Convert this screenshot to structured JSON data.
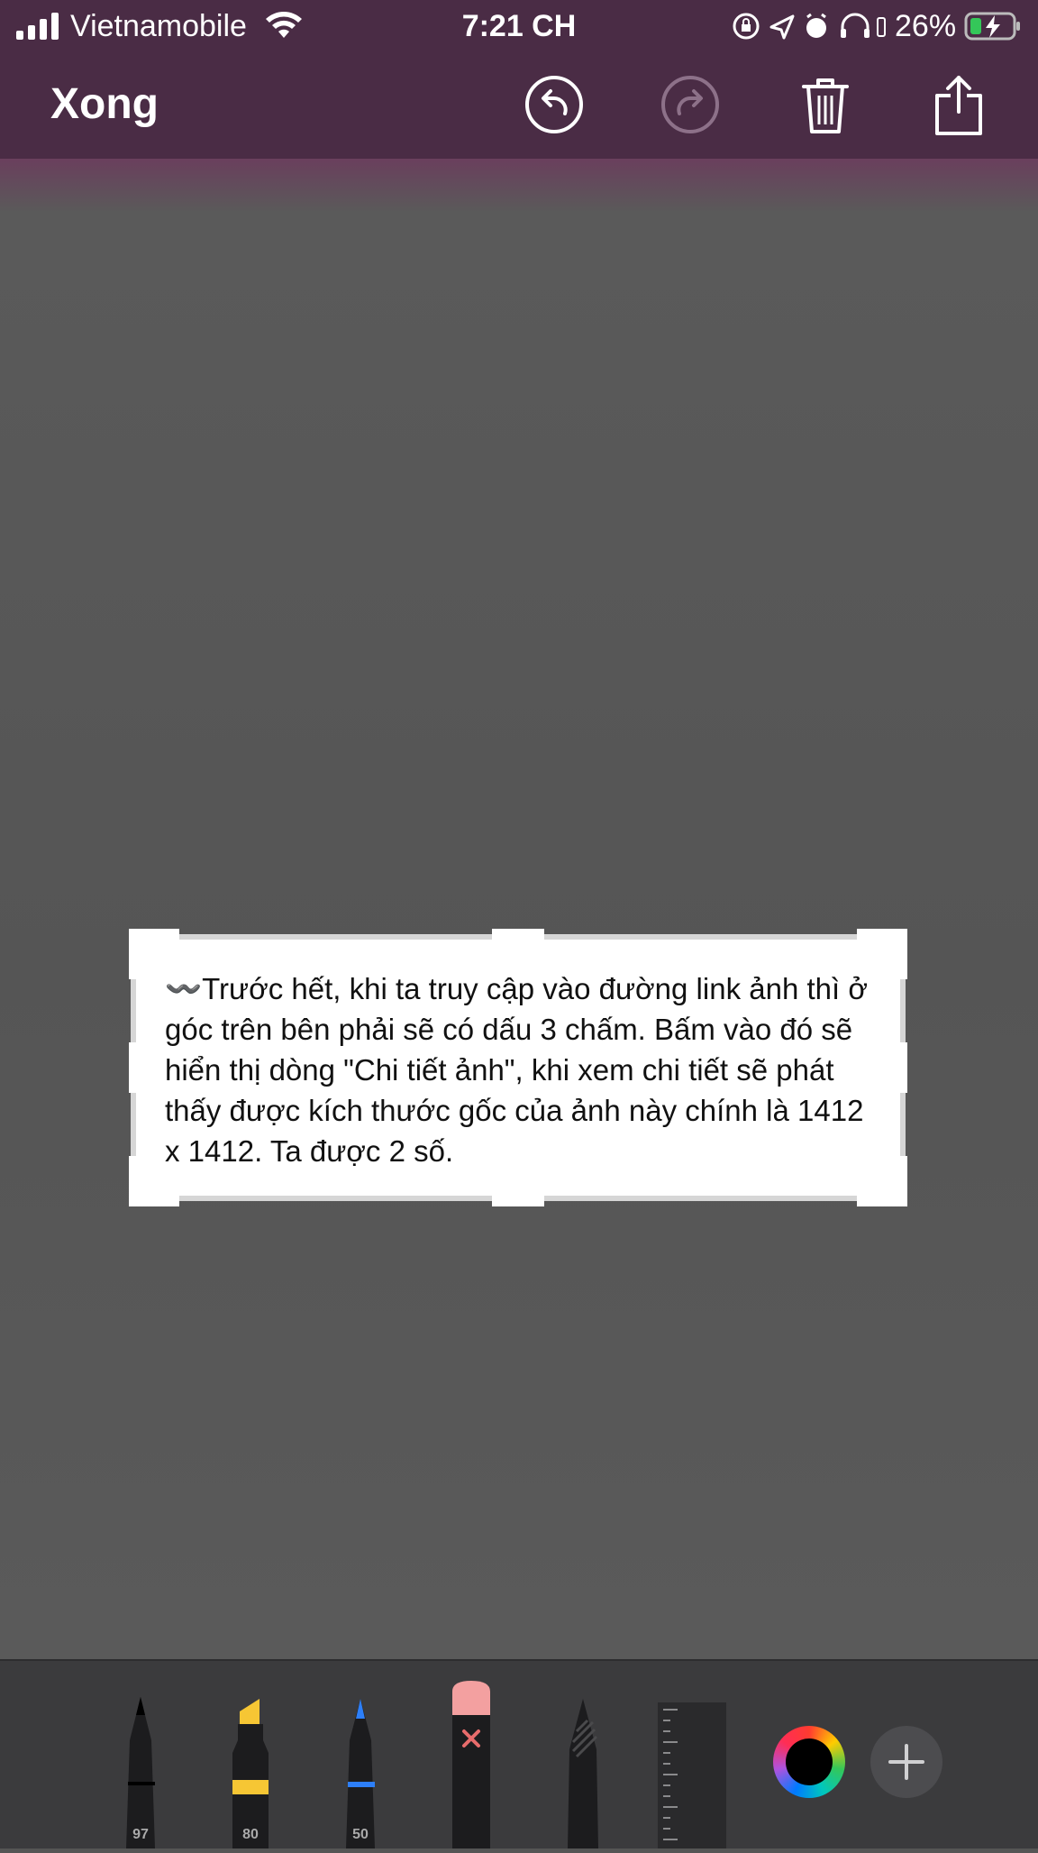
{
  "status_bar": {
    "carrier": "Vietnamobile",
    "time": "7:21 CH",
    "battery_percent": "26%",
    "icons": [
      "signal-icon",
      "wifi-icon",
      "orientation-lock-icon",
      "location-icon",
      "alarm-icon",
      "headphones-icon",
      "battery-charging-icon"
    ]
  },
  "header": {
    "done_label": "Xong",
    "actions": [
      "undo-icon",
      "redo-icon",
      "trash-icon",
      "share-icon"
    ],
    "redo_enabled": false
  },
  "document": {
    "text": "〰️Trước hết, khi ta truy cập vào đường link ảnh thì ở góc trên bên phải sẽ có dấu 3 chấm. Bấm vào đó sẽ hiển thị dòng \"Chi tiết ảnh\", khi xem chi tiết sẽ phát thấy được kích thước gốc của ảnh này chính là 1412 x 1412. Ta được 2 số."
  },
  "tools": [
    {
      "name": "pen",
      "label": "97"
    },
    {
      "name": "marker",
      "label": "80"
    },
    {
      "name": "pencil",
      "label": "50"
    },
    {
      "name": "eraser",
      "label": ""
    },
    {
      "name": "lasso",
      "label": ""
    },
    {
      "name": "ruler",
      "label": ""
    }
  ],
  "colors": {
    "header_bg": "#4a2c45",
    "selected_color": "#000000",
    "marker_color": "#f6c634",
    "pencil_color": "#2d7ff9",
    "eraser_color": "#f3a0a0"
  }
}
